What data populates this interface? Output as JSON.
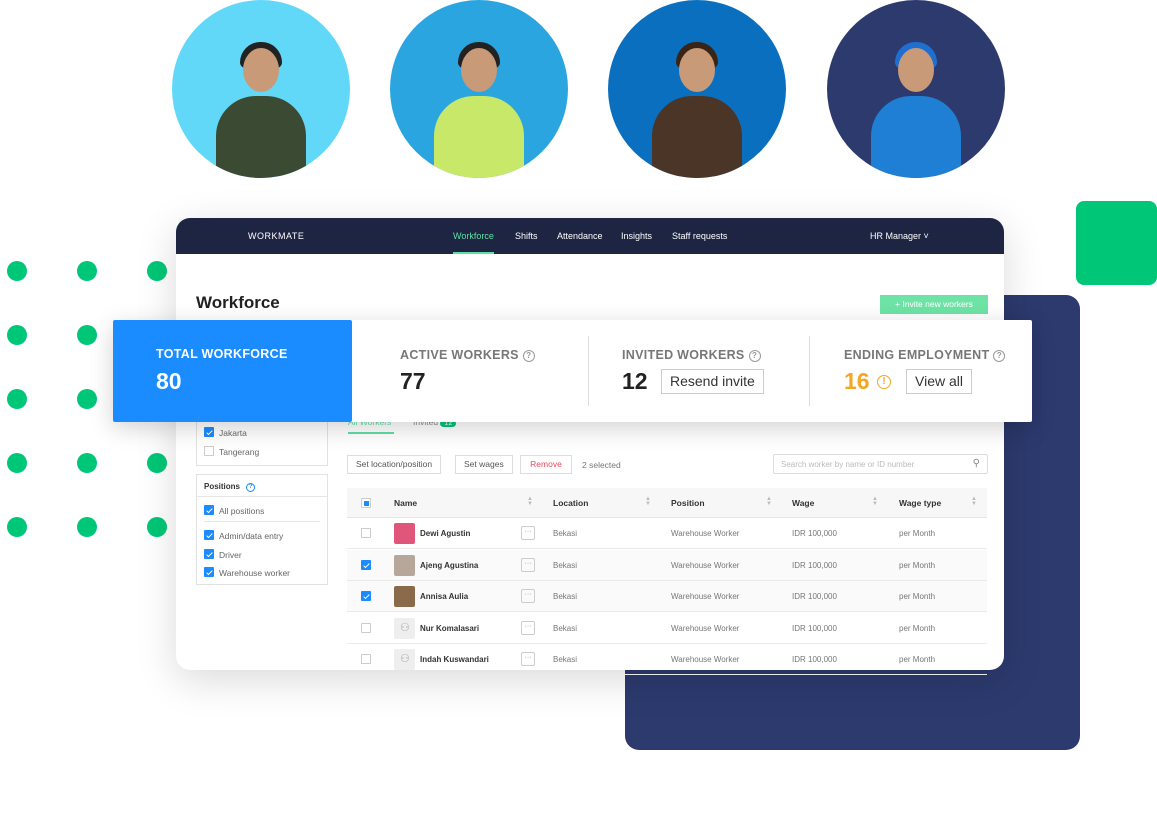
{
  "colors": {
    "accent": "#1a8cff",
    "green": "#00c677",
    "nav": "#1d2542",
    "navy_block": "#2c3a6e",
    "warning": "#f5a623",
    "danger": "#e84a5f",
    "active_tab": "#5ee0a4"
  },
  "hero_circles": [
    {
      "bg": "#62d8f9"
    },
    {
      "bg": "#2aa5e0"
    },
    {
      "bg": "#0b6fc0"
    },
    {
      "bg": "#2c3a6e"
    }
  ],
  "nav": {
    "logo": "WORKMATE",
    "tabs": [
      "Workforce",
      "Shifts",
      "Attendance",
      "Insights",
      "Staff requests"
    ],
    "active_tab": "Workforce",
    "user": "HR Manager ˅"
  },
  "page": {
    "title": "Workforce",
    "invite_button": "+ Invite new workers"
  },
  "stats": {
    "total": {
      "label": "TOTAL WORKFORCE",
      "value": "80"
    },
    "active": {
      "label": "ACTIVE WORKERS",
      "value": "77"
    },
    "invited": {
      "label": "INVITED WORKERS",
      "value": "12",
      "button": "Resend invite"
    },
    "ending": {
      "label": "ENDING EMPLOYMENT",
      "value": "16",
      "button": "View all"
    }
  },
  "filters": {
    "locations": [
      {
        "label": "Jakarta",
        "checked": true
      },
      {
        "label": "Tangerang",
        "checked": false
      }
    ],
    "positions_title": "Positions",
    "all_positions": "All positions",
    "positions": [
      {
        "label": "Admin/data entry",
        "checked": true
      },
      {
        "label": "Driver",
        "checked": true
      },
      {
        "label": "Warehouse worker",
        "checked": true
      }
    ]
  },
  "tabs": {
    "all": "All Workers",
    "invited": "Invited",
    "invited_count": "12"
  },
  "actions": {
    "set_location": "Set location/position",
    "set_wages": "Set wages",
    "remove": "Remove",
    "selected": "2 selected",
    "search_placeholder": "Search worker by name or ID number"
  },
  "table": {
    "headers": [
      "Name",
      "Location",
      "Position",
      "Wage",
      "Wage type"
    ],
    "rows": [
      {
        "name": "Dewi Agustin",
        "location": "Bekasi",
        "position": "Warehouse Worker",
        "wage": "IDR 100,000",
        "wage_type": "per Month",
        "checked": false,
        "photo": true,
        "more": "···"
      },
      {
        "name": "Ajeng Agustina",
        "location": "Bekasi",
        "position": "Warehouse Worker",
        "wage": "IDR 100,000",
        "wage_type": "per Month",
        "checked": true,
        "photo": true,
        "more": "···"
      },
      {
        "name": "Annisa Aulia",
        "location": "Bekasi",
        "position": "Warehouse Worker",
        "wage": "IDR 100,000",
        "wage_type": "per Month",
        "checked": true,
        "photo": true,
        "more": "···"
      },
      {
        "name": "Nur Komalasari",
        "location": "Bekasi",
        "position": "Warehouse Worker",
        "wage": "IDR 100,000",
        "wage_type": "per Month",
        "checked": false,
        "photo": false,
        "more": "···"
      },
      {
        "name": "Indah Kuswandari",
        "location": "Bekasi",
        "position": "Warehouse Worker",
        "wage": "IDR 100,000",
        "wage_type": "per Month",
        "checked": false,
        "photo": false,
        "more": "···"
      }
    ]
  }
}
